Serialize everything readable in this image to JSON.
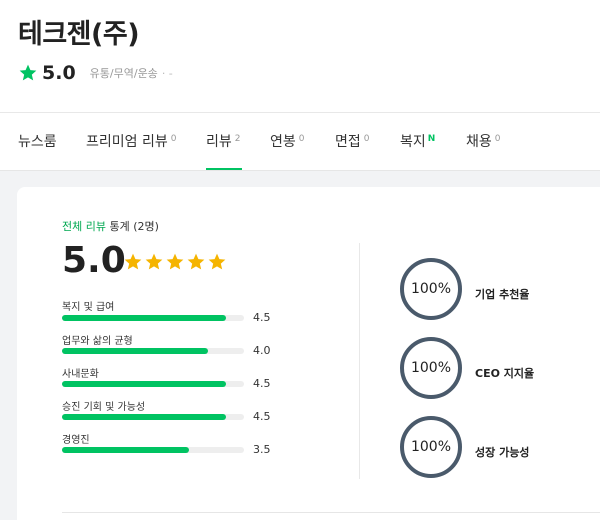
{
  "company": {
    "name": "테크젠(주)",
    "rating": "5.0",
    "industry": "유통/무역/운송",
    "dash": "· -"
  },
  "tabs": [
    {
      "label": "뉴스룸",
      "count": ""
    },
    {
      "label": "프리미엄 리뷰",
      "count": "0"
    },
    {
      "label": "리뷰",
      "count": "2"
    },
    {
      "label": "연봉",
      "count": "0"
    },
    {
      "label": "면접",
      "count": "0"
    },
    {
      "label": "복지",
      "badge": "N"
    },
    {
      "label": "채용",
      "count": "0"
    }
  ],
  "stats": {
    "title_highlight": "전체 리뷰",
    "title_rest": " 통계 (2명)",
    "score": "5.0",
    "star_count": 5,
    "metrics": [
      {
        "label": "복지 및 급여",
        "value": "4.5",
        "ratio": 0.9
      },
      {
        "label": "업무와 삶의 균형",
        "value": "4.0",
        "ratio": 0.8
      },
      {
        "label": "사내문화",
        "value": "4.5",
        "ratio": 0.9
      },
      {
        "label": "승진 기회 및 가능성",
        "value": "4.5",
        "ratio": 0.9
      },
      {
        "label": "경영진",
        "value": "3.5",
        "ratio": 0.7
      }
    ],
    "rings": [
      {
        "value": "100%",
        "label": "기업 추천율"
      },
      {
        "value": "100%",
        "label": "CEO 지지율"
      },
      {
        "value": "100%",
        "label": "성장 가능성"
      }
    ]
  },
  "colors": {
    "accent": "#00c362",
    "star": "#f5b400",
    "ring": "#4a5a6b"
  }
}
